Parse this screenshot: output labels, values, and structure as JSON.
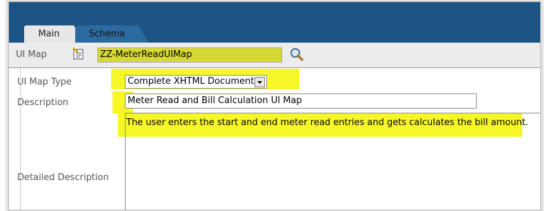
{
  "tabs": [
    {
      "label": "Main"
    },
    {
      "label": "Schema"
    }
  ],
  "ui_map": {
    "label": "UI Map",
    "value": "ZZ-MeterReadUIMap"
  },
  "ui_map_type": {
    "label": "UI Map Type",
    "value": "Complete XHTML Document"
  },
  "description": {
    "label": "Description",
    "value": "Meter Read and Bill Calculation UI Map"
  },
  "detailed_description": {
    "label": "Detailed Description",
    "value": "The user enters the start and end meter read entries and gets calculates the bill amount."
  },
  "colors": {
    "header": "#1c5486",
    "highlight": "#f7f728",
    "tab_active": "#e7e7e7",
    "tab_inactive": "#2d6aa0"
  },
  "icons": [
    "document-edit-icon",
    "search-icon",
    "dropdown-arrow-icon"
  ]
}
